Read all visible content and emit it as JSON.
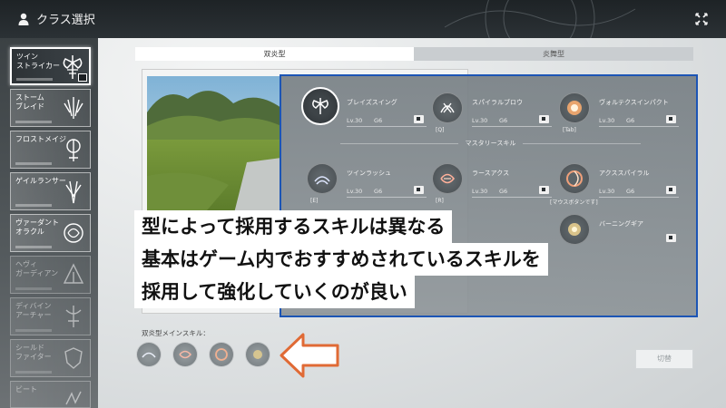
{
  "header": {
    "title": "クラス選択",
    "user_icon": "user-icon",
    "close_icon": "close-icon"
  },
  "sidebar": {
    "classes": [
      {
        "name": "ツイン\nストライカー",
        "icon": "twin-axe-icon",
        "selected": true
      },
      {
        "name": "ストーム\nブレイド",
        "icon": "storm-blade-icon",
        "selected": false
      },
      {
        "name": "フロストメイジ",
        "icon": "frost-staff-icon",
        "selected": false
      },
      {
        "name": "ゲイルランサー",
        "icon": "gale-lance-icon",
        "selected": false
      },
      {
        "name": "ヴァーダント\nオラクル",
        "icon": "verdant-oracle-icon",
        "selected": false
      },
      {
        "name": "ヘヴィ\nガーディアン",
        "icon": "heavy-guardian-icon",
        "selected": false
      },
      {
        "name": "ディバイン\nアーチャー",
        "icon": "divine-archer-icon",
        "selected": false
      },
      {
        "name": "シールド\nファイター",
        "icon": "shield-fighter-icon",
        "selected": false
      },
      {
        "name": "ビート",
        "icon": "beat-icon",
        "selected": false
      }
    ]
  },
  "tabs": [
    {
      "label": "双炎型",
      "active": true
    },
    {
      "label": "炎舞型",
      "active": false
    }
  ],
  "skills": {
    "row1": [
      {
        "name": "ブレイズスイング",
        "level": "Lv.30",
        "grade": "G6",
        "key": ""
      },
      {
        "name": "スパイラルブロウ",
        "level": "Lv.30",
        "grade": "G6",
        "key": "[Q]"
      },
      {
        "name": "ヴォルテクスインパクト",
        "level": "Lv.30",
        "grade": "G6",
        "key": "[Tab]"
      }
    ],
    "mastery_label": "マスタリースキル",
    "row2": [
      {
        "name": "ツインラッシュ",
        "level": "Lv.30",
        "grade": "G6",
        "key": "[E]"
      },
      {
        "name": "ラースアクス",
        "level": "Lv.30",
        "grade": "G6",
        "key": "[R]"
      },
      {
        "name": "アクススパイラル",
        "level": "Lv.30",
        "grade": "G6",
        "key": "[マウスボタンです]"
      }
    ],
    "row3": [
      {
        "name": "バーニングギア",
        "level": "",
        "grade": "",
        "key": ""
      }
    ]
  },
  "caption": {
    "line1": "型によって採用するスキルは異なる",
    "line2": "基本はゲーム内でおすすめされているスキルを",
    "line3": "採用して強化していくのが良い"
  },
  "main_skills": {
    "label": "双炎型メインスキル：",
    "icons": [
      "wave-slash-icon",
      "spiral-icon",
      "swirl-icon",
      "burning-gear-icon"
    ]
  },
  "switch_button": {
    "label": "切替"
  },
  "colors": {
    "panel_border": "#1c55b5",
    "pointer_arrow": "#e06a35"
  }
}
